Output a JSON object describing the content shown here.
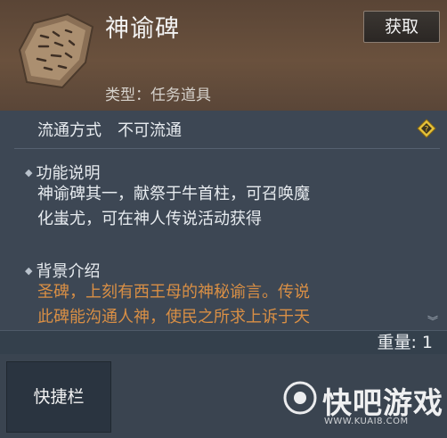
{
  "item": {
    "name": "神谕碑",
    "type_text": "类型：任务道具",
    "get_button": "获取",
    "icon": "stone-tablet-icon"
  },
  "circulation": {
    "label": "流通方式",
    "value": "不可流通"
  },
  "sections": {
    "function": {
      "title": "功能说明",
      "lines": [
        "神谕碑其一，献祭于牛首柱，可召唤魔",
        "化蚩尤，可在神人传说活动获得"
      ]
    },
    "background": {
      "title": "背景介绍",
      "lines": [
        "圣碑，上刻有西王母的神秘谕言。传说",
        "此碑能沟通人神，使民之所求上诉于天"
      ]
    }
  },
  "weight": "重量: 1",
  "quick_bar": "快捷栏",
  "watermark": {
    "text": "快吧游戏",
    "url": "WWW.KUAI8.COM"
  },
  "colors": {
    "header_bg": "#6a513d",
    "panel_bg": "#3d4754",
    "lore_text": "#d98f45",
    "diamond_gold": "#e6c23a"
  }
}
